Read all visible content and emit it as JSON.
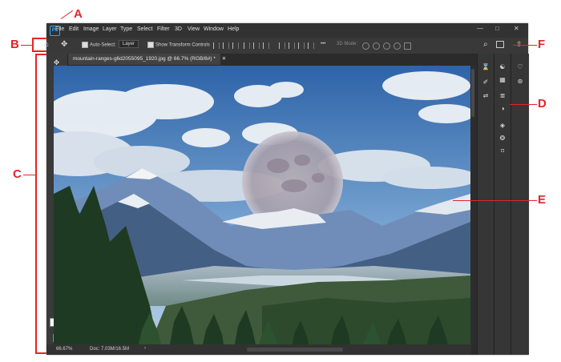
{
  "app": {
    "logo": "Ps"
  },
  "menu": [
    "File",
    "Edit",
    "Image",
    "Layer",
    "Type",
    "Select",
    "Filter",
    "3D",
    "View",
    "Window",
    "Help"
  ],
  "window_controls": {
    "minimize": "—",
    "maximize": "□",
    "close": "✕"
  },
  "options": {
    "auto_select_label": "Auto-Select:",
    "auto_select_target": "Layer",
    "transform_label": "Show Transform Controls",
    "mode_3d_label": "3D Mode:",
    "more": "•••"
  },
  "document": {
    "tab_title": "mountain-ranges-g6d2055095_1920.jpg @ 66.7% (RGB/8#) *",
    "close": "✕",
    "zoom": "66.67%",
    "doc_info": "Doc: 7.03M/16.5M",
    "arrow": "›"
  },
  "callouts": {
    "a": "A",
    "b": "B",
    "c": "C",
    "d": "D",
    "e": "E",
    "f": "F"
  },
  "colors": {
    "accent_red": "#e5242a",
    "ps_blue": "#31a8ff",
    "panel_dark": "#2b2b2b"
  },
  "tools_icons": [
    "move-icon",
    "marquee-icon",
    "lasso-icon",
    "quick-select-icon",
    "crop-icon",
    "frame-icon",
    "eyedropper-icon",
    "healing-icon",
    "brush-icon",
    "stamp-icon",
    "history-brush-icon",
    "eraser-icon",
    "gradient-icon",
    "blur-icon",
    "dodge-icon",
    "pen-icon",
    "type-icon",
    "path-select-icon",
    "rectangle-icon",
    "hand-icon",
    "zoom-icon",
    "more-tools-icon"
  ]
}
